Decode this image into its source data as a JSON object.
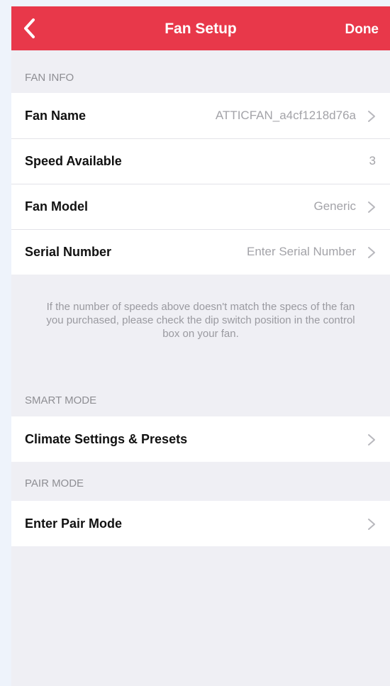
{
  "nav": {
    "title": "Fan Setup",
    "done_label": "Done",
    "back_icon": "chevron-left-icon",
    "bar_color": "#e8384a"
  },
  "fan_info": {
    "header": "FAN INFO",
    "rows": [
      {
        "label": "Fan Name",
        "value": "ATTICFAN_a4cf1218d76a",
        "chevron": true
      },
      {
        "label": "Speed Available",
        "value": "3",
        "chevron": false
      },
      {
        "label": "Fan Model",
        "value": "Generic",
        "chevron": true
      },
      {
        "label": "Serial Number",
        "value": "Enter Serial Number",
        "chevron": true
      }
    ],
    "footnote": "If the number of speeds above doesn't match the specs of the fan you purchased, please check the dip switch position in the control box on your fan."
  },
  "smart_mode": {
    "header": "SMART MODE",
    "rows": [
      {
        "label": "Climate Settings & Presets",
        "chevron": true
      }
    ]
  },
  "pair_mode": {
    "header": "PAIR MODE",
    "rows": [
      {
        "label": "Enter Pair Mode",
        "chevron": true
      }
    ]
  }
}
